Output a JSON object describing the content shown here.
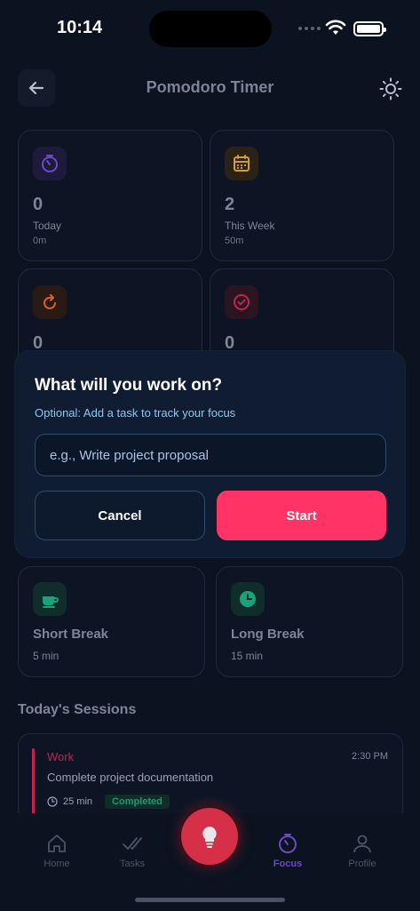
{
  "status": {
    "time": "10:14"
  },
  "app_bar": {
    "title": "Pomodoro Timer",
    "back_icon": "arrow-left-icon",
    "theme_icon": "sun-icon"
  },
  "stats": [
    {
      "value": "0",
      "label": "Today",
      "sub": "0m",
      "icon": "timer-icon",
      "color": "#6a4bc4",
      "bg": "#1e1a3a"
    },
    {
      "value": "2",
      "label": "This Week",
      "sub": "50m",
      "icon": "calendar-icon",
      "color": "#d69a2d",
      "bg": "#2a2214"
    },
    {
      "value": "0",
      "icon": "refresh-icon",
      "color": "#d4612f",
      "bg": "#2a1a16"
    },
    {
      "value": "0",
      "icon": "check-circle-icon",
      "color": "#c4234f",
      "bg": "#2a1520"
    }
  ],
  "modal": {
    "title": "What will you work on?",
    "subtitle": "Optional: Add a task to track your focus",
    "placeholder": "e.g., Write project proposal",
    "cancel_label": "Cancel",
    "start_label": "Start",
    "start_color": "#ff3366"
  },
  "breaks": [
    {
      "title": "Short Break",
      "duration": "5 min",
      "icon": "coffee-icon"
    },
    {
      "title": "Long Break",
      "duration": "15 min",
      "icon": "clock-icon"
    }
  ],
  "sessions": {
    "title": "Today's Sessions",
    "items": [
      {
        "type": "Work",
        "time": "2:30 PM",
        "task": "Complete project documentation",
        "duration": "25 min",
        "status": "Completed"
      }
    ]
  },
  "tabbar": {
    "tabs": [
      {
        "label": "Home",
        "icon": "home-icon"
      },
      {
        "label": "Tasks",
        "icon": "checks-icon"
      },
      {
        "label": "Focus",
        "icon": "timer-icon",
        "active": true
      },
      {
        "label": "Profile",
        "icon": "user-icon"
      }
    ],
    "fab_icon": "lightbulb-icon",
    "accent": "#6a4bc4"
  }
}
